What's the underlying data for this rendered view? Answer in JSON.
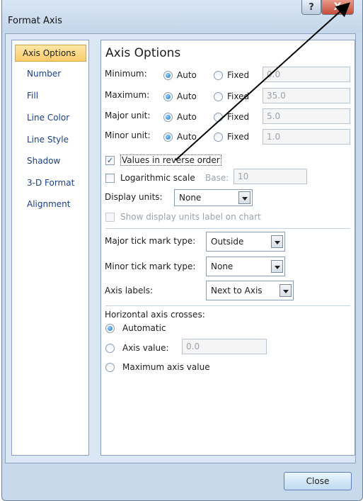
{
  "window": {
    "title": "Format Axis",
    "help_glyph": "?",
    "close_glyph": "X"
  },
  "nav": {
    "items": [
      {
        "label": "Axis Options",
        "selected": true
      },
      {
        "label": "Number"
      },
      {
        "label": "Fill"
      },
      {
        "label": "Line Color"
      },
      {
        "label": "Line Style"
      },
      {
        "label": "Shadow"
      },
      {
        "label": "3-D Format"
      },
      {
        "label": "Alignment"
      }
    ]
  },
  "axis_options": {
    "heading": "Axis Options",
    "rows": [
      {
        "label": "Minimum:",
        "auto_label": "Auto",
        "fixed_label": "Fixed",
        "selected": "Auto",
        "value": "0.0"
      },
      {
        "label": "Maximum:",
        "auto_label": "Auto",
        "fixed_label": "Fixed",
        "selected": "Auto",
        "value": "35.0"
      },
      {
        "label": "Major unit:",
        "auto_label": "Auto",
        "fixed_label": "Fixed",
        "selected": "Auto",
        "value": "5.0"
      },
      {
        "label": "Minor unit:",
        "auto_label": "Auto",
        "fixed_label": "Fixed",
        "selected": "Auto",
        "value": "1.0"
      }
    ],
    "values_reverse": {
      "label": "Values in reverse order",
      "checked": true
    },
    "log_scale": {
      "label": "Logarithmic scale",
      "checked": false,
      "base_label": "Base:",
      "base_value": "10"
    },
    "display_units": {
      "label": "Display units:",
      "value": "None"
    },
    "show_units_label": {
      "label": "Show display units label on chart",
      "checked": false,
      "enabled": false
    },
    "major_tick": {
      "label": "Major tick mark type:",
      "value": "Outside"
    },
    "minor_tick": {
      "label": "Minor tick mark type:",
      "value": "None"
    },
    "axis_labels": {
      "label": "Axis labels:",
      "value": "Next to Axis"
    },
    "crosses": {
      "label": "Horizontal axis crosses:",
      "automatic": "Automatic",
      "axis_value": "Axis value:",
      "axis_value_input": "0.0",
      "maximum": "Maximum axis value",
      "selected": "Automatic"
    }
  },
  "close_button": "Close",
  "colors": {
    "selected_nav": "#f8cc6a",
    "accent": "#1f6fc0",
    "window_frame": "#c9d9ec"
  }
}
